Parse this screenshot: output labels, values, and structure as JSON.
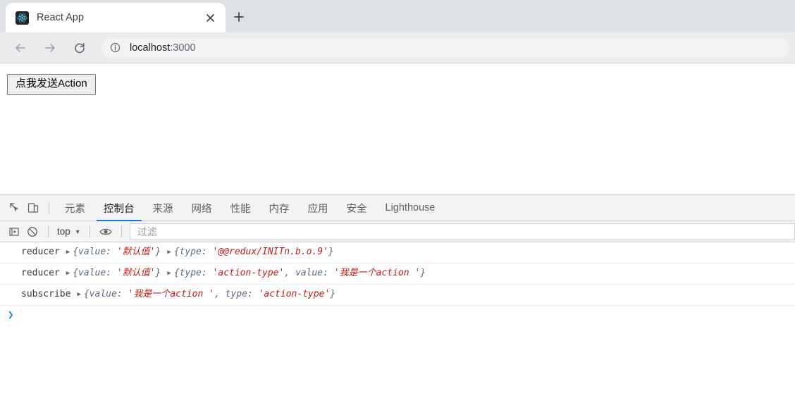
{
  "browser": {
    "tab": {
      "title": "React App",
      "favicon_name": "react-logo-icon",
      "close_label": "×"
    },
    "new_tab_label": "+",
    "nav": {
      "back_label": "←",
      "forward_label": "→",
      "reload_label": "↻"
    },
    "omnibox": {
      "info_icon": "site-info-icon",
      "host": "localhost",
      "port": ":3000"
    }
  },
  "page": {
    "button_label": "点我发送Action"
  },
  "devtools": {
    "icons": {
      "inspect": "inspect-element-icon",
      "device": "device-toolbar-icon",
      "execute": "execute-snippet-icon",
      "clear": "clear-console-icon",
      "eye": "live-expression-icon"
    },
    "tabs": [
      {
        "label": "元素",
        "active": false
      },
      {
        "label": "控制台",
        "active": true
      },
      {
        "label": "来源",
        "active": false
      },
      {
        "label": "网络",
        "active": false
      },
      {
        "label": "性能",
        "active": false
      },
      {
        "label": "内存",
        "active": false
      },
      {
        "label": "应用",
        "active": false
      },
      {
        "label": "安全",
        "active": false
      },
      {
        "label": "Lighthouse",
        "active": false
      }
    ],
    "console_toolbar": {
      "context": "top",
      "context_caret": "▼",
      "filter_placeholder": "过滤"
    },
    "console_rows": [
      {
        "label": "reducer",
        "objects": [
          {
            "disclosure": "▶",
            "parts": [
              {
                "t": "punc",
                "v": "{"
              },
              {
                "t": "key",
                "v": "value:"
              },
              {
                "t": "sp",
                "v": " "
              },
              {
                "t": "str",
                "v": "'默认值'"
              },
              {
                "t": "punc",
                "v": "}"
              }
            ]
          },
          {
            "disclosure": "▶",
            "parts": [
              {
                "t": "punc",
                "v": "{"
              },
              {
                "t": "key",
                "v": "type:"
              },
              {
                "t": "sp",
                "v": " "
              },
              {
                "t": "str",
                "v": "'@@redux/INITn.b.o.9'"
              },
              {
                "t": "punc",
                "v": "}"
              }
            ]
          }
        ]
      },
      {
        "label": "reducer",
        "objects": [
          {
            "disclosure": "▶",
            "parts": [
              {
                "t": "punc",
                "v": "{"
              },
              {
                "t": "key",
                "v": "value:"
              },
              {
                "t": "sp",
                "v": " "
              },
              {
                "t": "str",
                "v": "'默认值'"
              },
              {
                "t": "punc",
                "v": "}"
              }
            ]
          },
          {
            "disclosure": "▶",
            "parts": [
              {
                "t": "punc",
                "v": "{"
              },
              {
                "t": "key",
                "v": "type:"
              },
              {
                "t": "sp",
                "v": " "
              },
              {
                "t": "str",
                "v": "'action-type'"
              },
              {
                "t": "punc",
                "v": ", "
              },
              {
                "t": "key",
                "v": "value:"
              },
              {
                "t": "sp",
                "v": " "
              },
              {
                "t": "str",
                "v": "'我是一个action '"
              },
              {
                "t": "punc",
                "v": "}"
              }
            ]
          }
        ]
      },
      {
        "label": "subscribe",
        "objects": [
          {
            "disclosure": "▶",
            "parts": [
              {
                "t": "punc",
                "v": "{"
              },
              {
                "t": "key",
                "v": "value:"
              },
              {
                "t": "sp",
                "v": " "
              },
              {
                "t": "str",
                "v": "'我是一个action '"
              },
              {
                "t": "punc",
                "v": ", "
              },
              {
                "t": "key",
                "v": "type:"
              },
              {
                "t": "sp",
                "v": " "
              },
              {
                "t": "str",
                "v": "'action-type'"
              },
              {
                "t": "punc",
                "v": "}"
              }
            ]
          }
        ]
      }
    ],
    "prompt_caret": "❯"
  },
  "colors": {
    "accent": "#1a73e8",
    "string": "#c41a16",
    "key": "#5c6b84",
    "tabstrip": "#dee1e6",
    "toolbar": "#eaebec"
  }
}
